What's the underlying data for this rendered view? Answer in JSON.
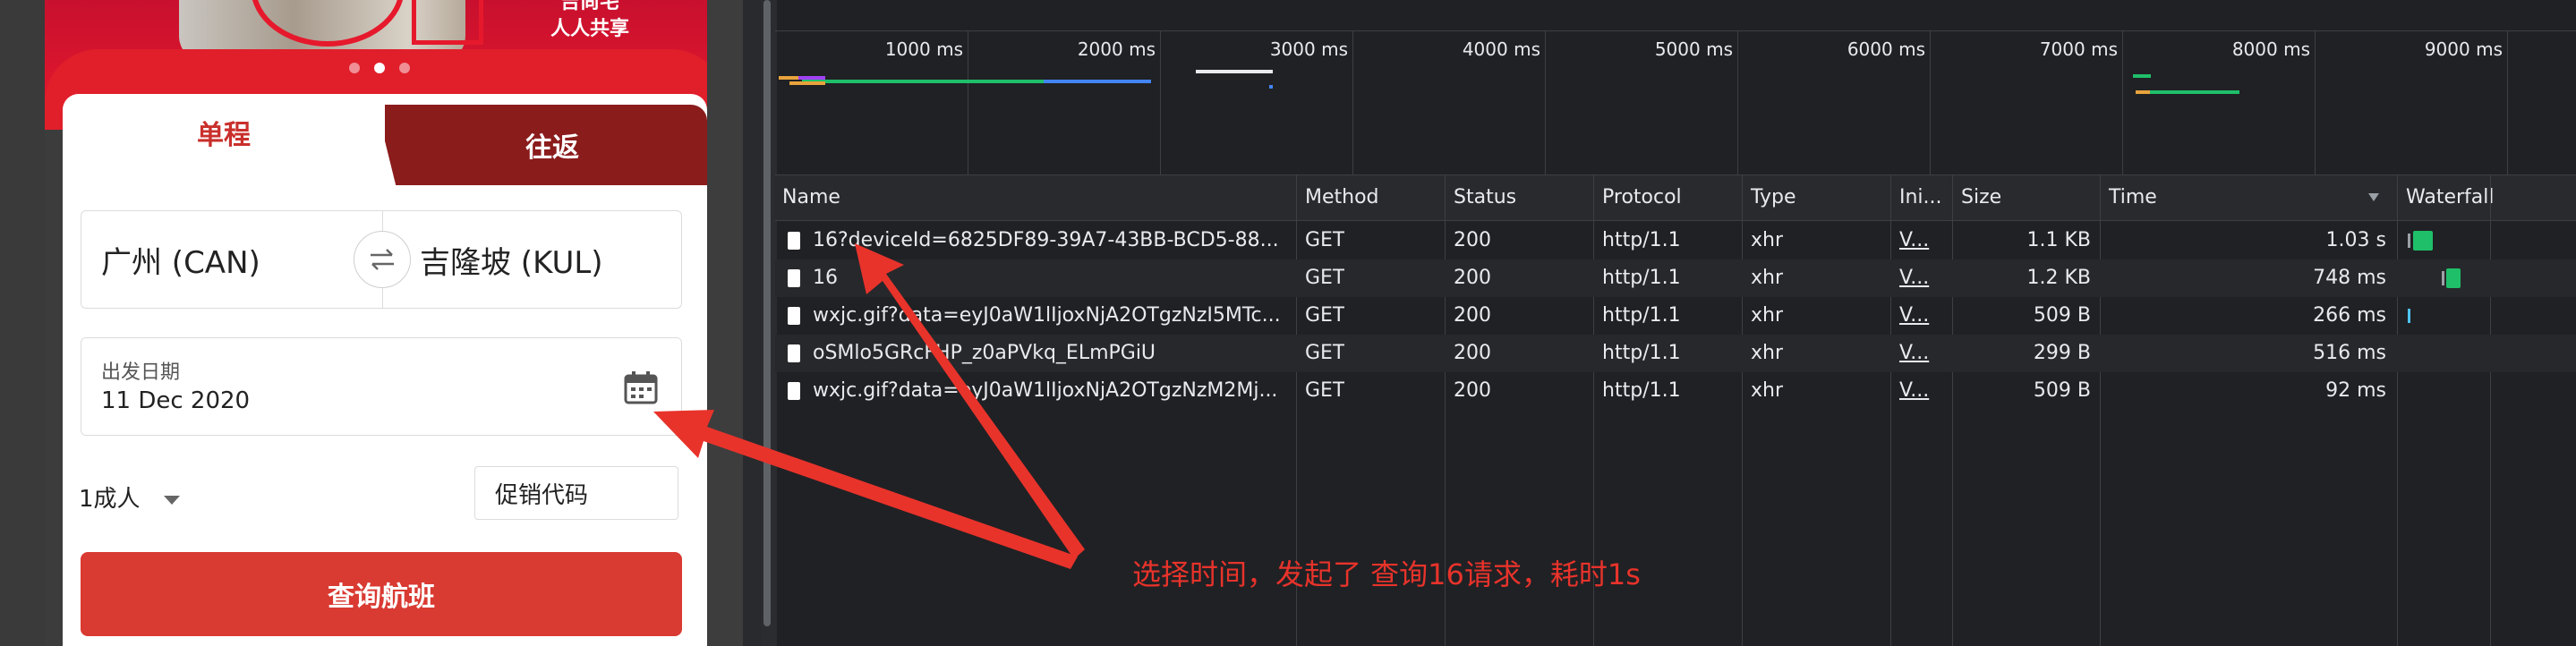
{
  "mobile": {
    "banner": {
      "slogan_line1": "吉尚宅",
      "slogan_line2": "人人共享",
      "carousel_dots": 3,
      "active_dot": 1
    },
    "tabs": {
      "oneway": "单程",
      "return": "往返"
    },
    "route": {
      "from": "广州 (CAN)",
      "to": "吉隆坡 (KUL)",
      "swap_icon": "swap-arrows-icon"
    },
    "date": {
      "label": "出发日期",
      "value": "11 Dec 2020",
      "icon": "calendar-icon"
    },
    "passengers": "1成人",
    "promo_placeholder": "促销代码",
    "search_button": "查询航班",
    "colors": {
      "brand_red": "#d93a32",
      "tab_dark": "#8b1c1c",
      "selected_tab_text": "#c9302c"
    }
  },
  "devtools": {
    "overview": {
      "ticks": [
        "1000 ms",
        "2000 ms",
        "3000 ms",
        "4000 ms",
        "5000 ms",
        "6000 ms",
        "7000 ms",
        "8000 ms",
        "9000 ms"
      ]
    },
    "columns": {
      "name": "Name",
      "method": "Method",
      "status": "Status",
      "protocol": "Protocol",
      "type": "Type",
      "initiator": "Ini...",
      "size": "Size",
      "time": "Time",
      "waterfall": "Waterfall"
    },
    "rows": [
      {
        "name": "16?deviceId=6825DF89-39A7-43BB-BCD5-88...",
        "method": "GET",
        "status": "200",
        "protocol": "http/1.1",
        "type": "xhr",
        "initiator": "V...",
        "size": "1.1 KB",
        "time": "1.03 s"
      },
      {
        "name": "16",
        "method": "GET",
        "status": "200",
        "protocol": "http/1.1",
        "type": "xhr",
        "initiator": "V...",
        "size": "1.2 KB",
        "time": "748 ms"
      },
      {
        "name": "wxjc.gif?data=eyJ0aW1lIjoxNjA2OTgzNzI5MTc...",
        "method": "GET",
        "status": "200",
        "protocol": "http/1.1",
        "type": "xhr",
        "initiator": "V...",
        "size": "509 B",
        "time": "266 ms"
      },
      {
        "name": "oSMlo5GRcFHP_z0aPVkq_ELmPGiU",
        "method": "GET",
        "status": "200",
        "protocol": "http/1.1",
        "type": "xhr",
        "initiator": "V...",
        "size": "299 B",
        "time": "516 ms"
      },
      {
        "name": "wxjc.gif?data=eyJ0aW1lIjoxNjA2OTgzNzM2Mj...",
        "method": "GET",
        "status": "200",
        "protocol": "http/1.1",
        "type": "xhr",
        "initiator": "V...",
        "size": "509 B",
        "time": "92 ms"
      }
    ],
    "colors": {
      "background": "#202124",
      "waterfall_green": "#1fbf6a"
    }
  },
  "annotation": {
    "text": "选择时间，发起了 查询16请求，耗时1s",
    "color": "#e8332b"
  }
}
